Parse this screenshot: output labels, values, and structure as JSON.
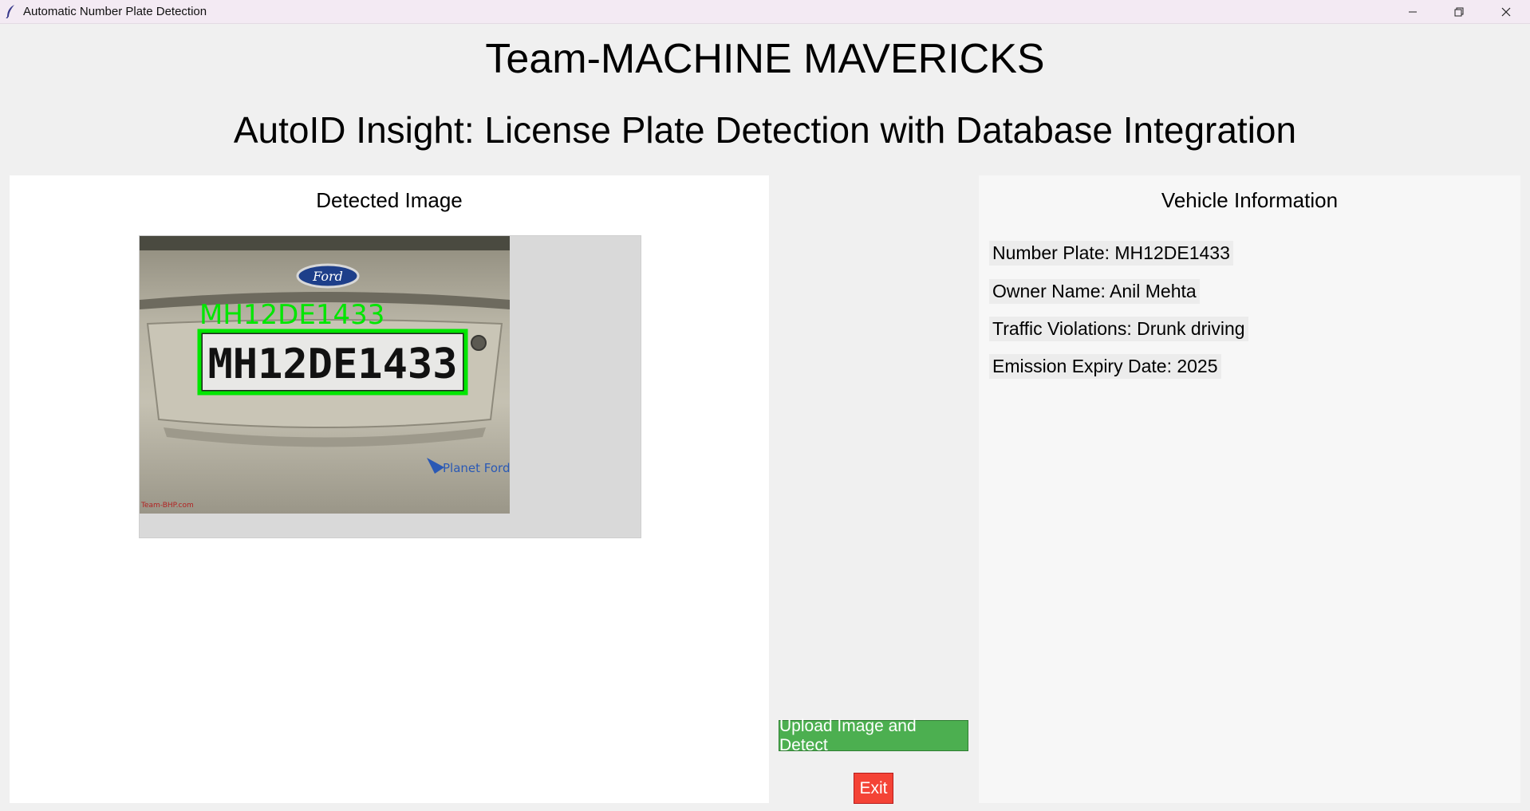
{
  "window": {
    "title": "Automatic Number Plate Detection",
    "icon": "feather-icon"
  },
  "header": {
    "team": "Team-MACHINE MAVERICKS",
    "subtitle": "AutoID Insight: License Plate Detection with Database Integration"
  },
  "detected_panel": {
    "title": "Detected Image",
    "image": {
      "detection_label": "MH12DE1433",
      "plate_text": "MH12DE1433",
      "brand_badge": "Ford",
      "dealer_text": "Planet Ford",
      "watermark": "Team-BHP.com",
      "box_color": "#00e600"
    }
  },
  "vehicle_info": {
    "title": "Vehicle Information",
    "fields": [
      "Number Plate: MH12DE1433",
      "Owner Name: Anil Mehta",
      "Traffic Violations: Drunk driving",
      "Emission Expiry Date: 2025"
    ]
  },
  "actions": {
    "upload_label": "Upload Image and Detect",
    "exit_label": "Exit",
    "upload_color": "#4caf50",
    "exit_color": "#f44336"
  }
}
